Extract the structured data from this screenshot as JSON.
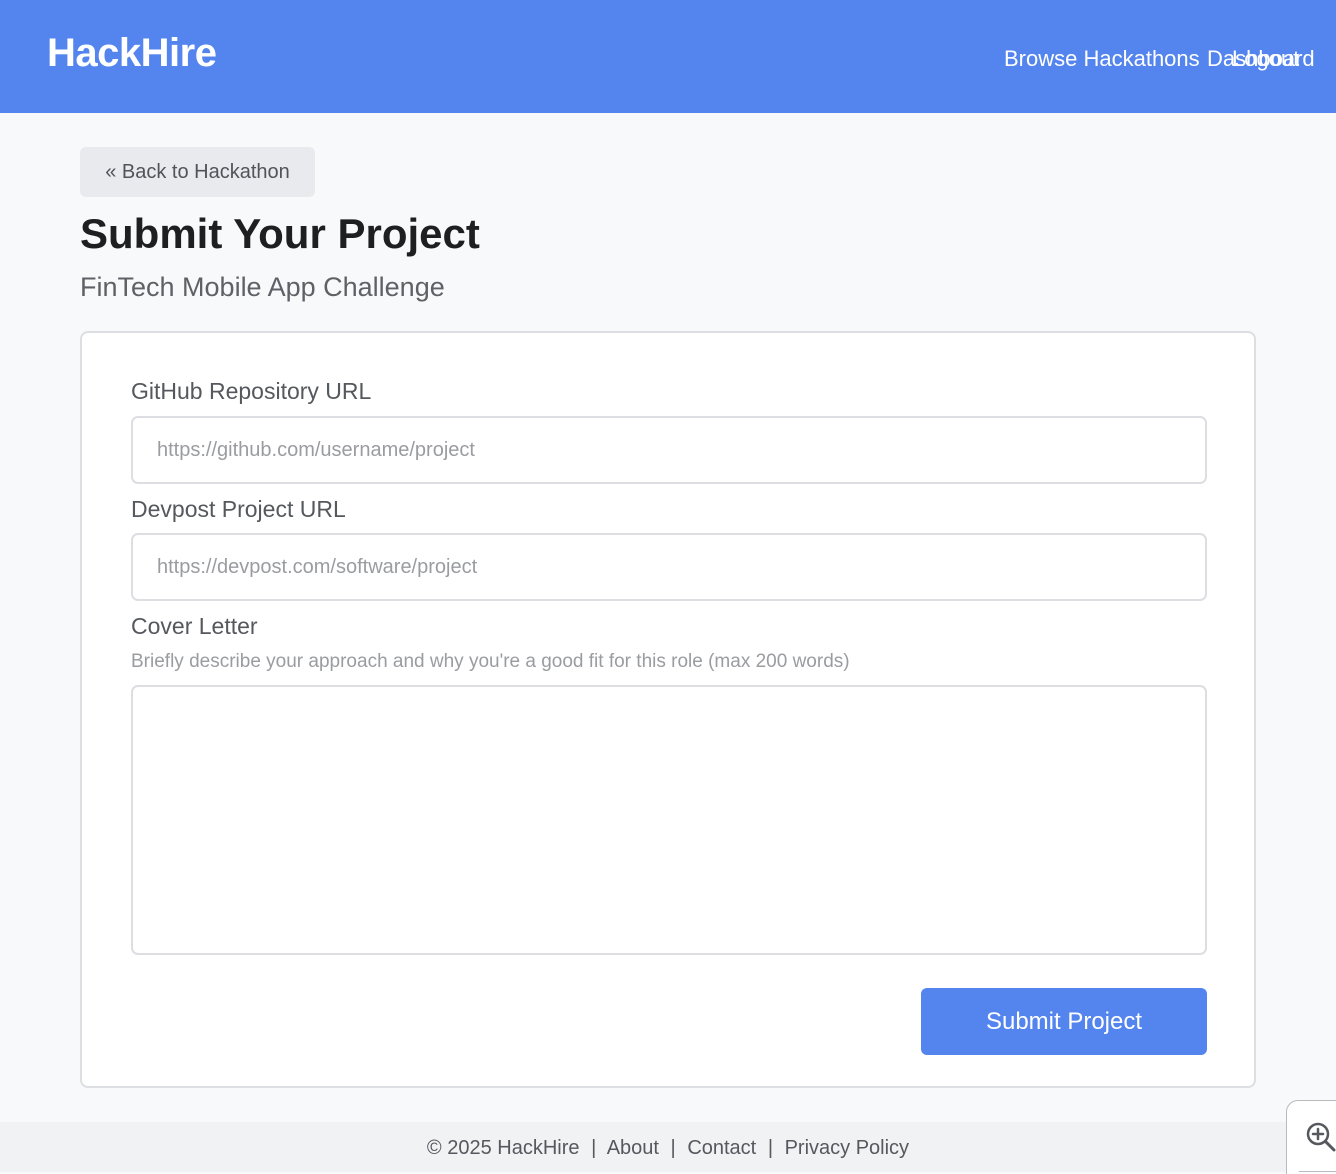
{
  "header": {
    "brand": "HackHire",
    "nav": {
      "browse": "Browse Hackathons",
      "dashboard": "Dashboard",
      "logout": "Logout"
    }
  },
  "back_button": "« Back to Hackathon",
  "page": {
    "title": "Submit Your Project",
    "subtitle": "FinTech Mobile App Challenge"
  },
  "form": {
    "github": {
      "label": "GitHub Repository URL",
      "placeholder": "https://github.com/username/project",
      "value": ""
    },
    "devpost": {
      "label": "Devpost Project URL",
      "placeholder": "https://devpost.com/software/project",
      "value": ""
    },
    "cover_letter": {
      "label": "Cover Letter",
      "hint": "Briefly describe your approach and why you're a good fit for this role (max 200 words)",
      "value": ""
    },
    "submit_label": "Submit Project"
  },
  "footer": {
    "copyright": "© 2025 HackHire",
    "separator": "|",
    "about": "About",
    "contact": "Contact",
    "privacy": "Privacy Policy"
  },
  "icons": {
    "zoom": "zoom-in-icon"
  },
  "colors": {
    "primary": "#5485ee",
    "background": "#f8f9fb",
    "text": "#1e1f21",
    "muted": "#9a9ca0"
  }
}
